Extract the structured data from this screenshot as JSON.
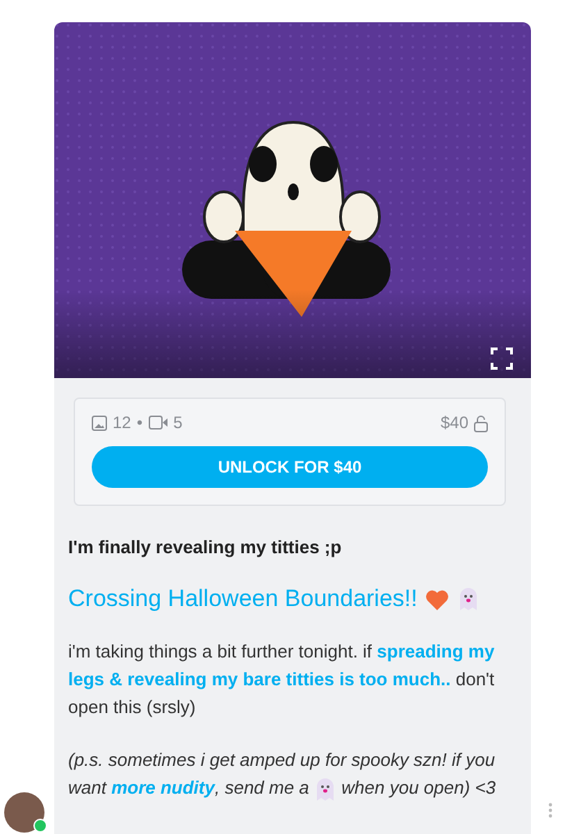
{
  "post": {
    "media": {
      "photos": "12",
      "separator": "•",
      "videos": "5",
      "price": "$40"
    },
    "unlock_button": "UNLOCK FOR $40",
    "headline": "I'm finally revealing my titties ;p",
    "title": "Crossing Halloween Boundaries!!",
    "paragraphs": [
      {
        "italic": false,
        "text": "i'm taking things a bit further tonight. if **spreading my legs & revealing my bare titties is too much..** don't open this (srsly)"
      },
      {
        "italic": true,
        "text": "(p.s. sometimes i get amped up for spooky szn! if you",
        "before": "want **more nudity**, send me a",
        "after": "when you open) <3"
      }
    ]
  },
  "sender": {
    "online": true
  }
}
